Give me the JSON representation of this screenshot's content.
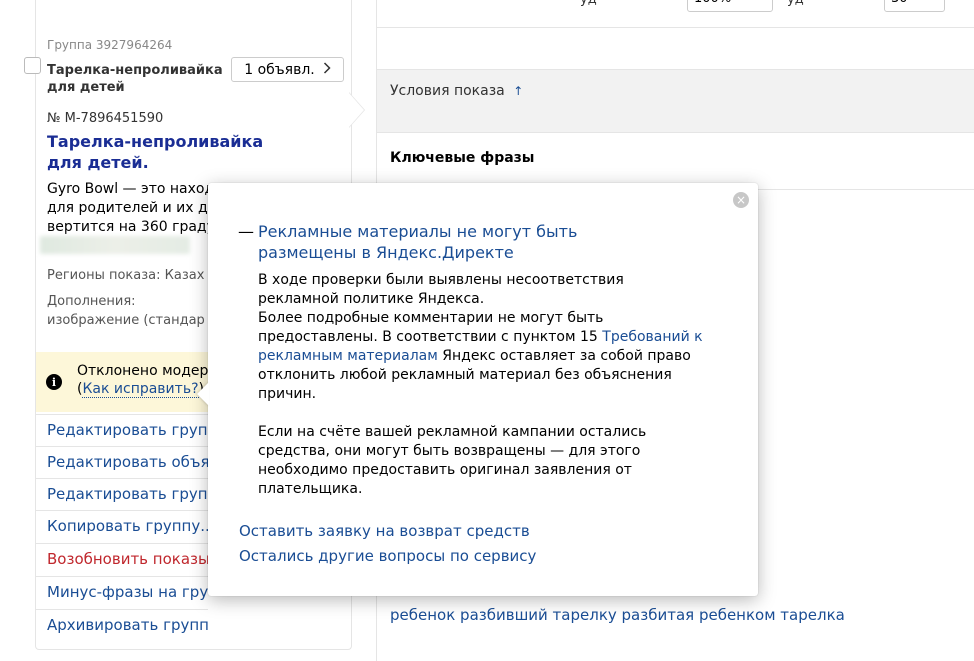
{
  "top": {
    "label1": "уд",
    "value1": "100%",
    "label2": "уд",
    "value2": "30"
  },
  "group": {
    "id_text": "Группа 3927964264",
    "name": "Тарелка-непроливайка для детей",
    "ads_button": "1 объявл.",
    "ad_number": "№ M-7896451590",
    "ad_title": "Тарелка-непроливайка для детей.",
    "ad_text_lines": [
      "Gyro Bowl — это наход",
      "для родителей и их д",
      "вертится на 360 граду"
    ],
    "regions": "Регионы показа:  Казах",
    "extras_label": "Дополнения:",
    "extras_value": "изображение (стандар",
    "rejected_text": "Отклонено модера",
    "rejected_link_prefix": "(",
    "rejected_link": "Как исправить?",
    "rejected_link_suffix": ")",
    "menu": [
      {
        "label": "Редактировать групп",
        "color": "#1a4d94"
      },
      {
        "label": "Редактировать объяв",
        "color": "#1a4d94"
      },
      {
        "label": "Редактировать групп",
        "color": "#1a4d94"
      },
      {
        "label": "Копировать группу...",
        "color": "#1a4d94"
      },
      {
        "label": "Возобновить показы",
        "color": "#c0272d"
      },
      {
        "label": "Минус-фразы на групу",
        "color": "#1a4d94"
      },
      {
        "label": "Архивировать группу",
        "color": "#1a4d94"
      }
    ]
  },
  "table": {
    "conditions_label": "Условия показа",
    "sort_arrow": "↑",
    "keywords_label": "Ключевые фразы",
    "phrases": "ребенок разбивший тарелку разбитая ребенком тарелка"
  },
  "popup": {
    "close": "×",
    "dash": "—",
    "title": "Рекламные материалы не могут быть размещены в Яндекс.Директе",
    "para1_a": "В ходе проверки были выявлены несоответствия рекламной политике Яндекса.",
    "para1_b": "Более подробные комментарии не могут быть предоставлены. В соответствии с пунктом 15 ",
    "para1_link": "Требований к рекламным материалам",
    "para1_c": " Яндекс оставляет за собой право отклонить любой рекламный материал без объяснения причин.",
    "para2": "Если на счёте вашей рекламной кампании остались средства, они могут быть возвращены — для этого необходимо предоставить оригинал заявления от плательщика.",
    "link1": "Оставить заявку на возврат средств",
    "link2": "Остались другие вопросы по сервису"
  },
  "colors": {
    "link": "#1a4d94",
    "title": "#1a2d94",
    "warning_bg": "#fdf7d9",
    "danger": "#c0272d"
  }
}
